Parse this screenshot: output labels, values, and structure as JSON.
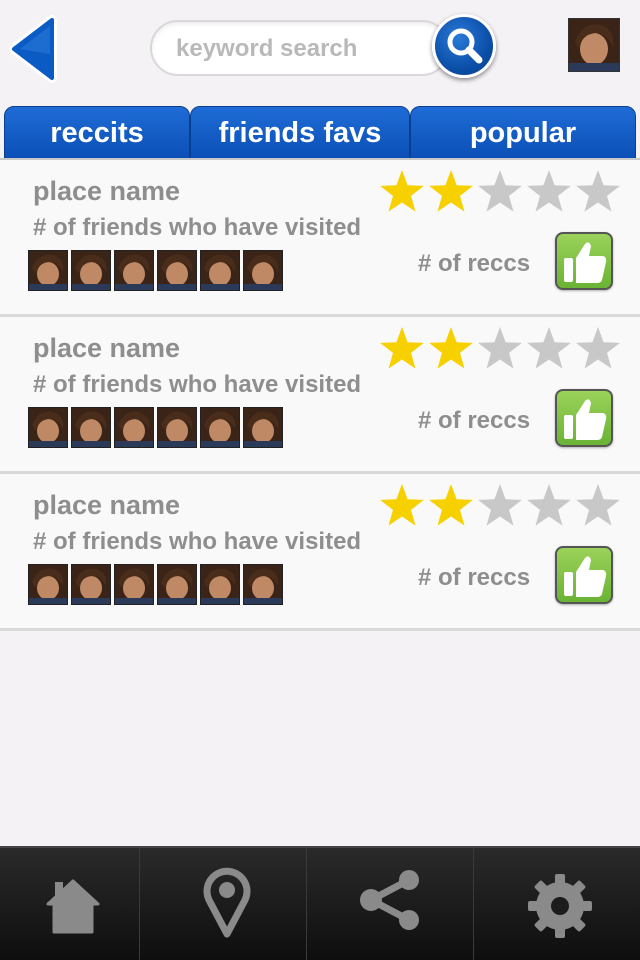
{
  "header": {
    "search_placeholder": "keyword search",
    "back_icon": "back-arrow-icon",
    "search_icon": "magnifier-icon"
  },
  "tabs": [
    {
      "label": "reccits"
    },
    {
      "label": "friends favs"
    },
    {
      "label": "popular"
    }
  ],
  "places": [
    {
      "name": "place name",
      "friends_text": "# of friends who have visited",
      "reccs_text": "# of reccs",
      "rating": 2,
      "max_rating": 5,
      "friend_count": 6
    },
    {
      "name": "place name",
      "friends_text": "# of friends who have visited",
      "reccs_text": "# of reccs",
      "rating": 2,
      "max_rating": 5,
      "friend_count": 6
    },
    {
      "name": "place name",
      "friends_text": "# of friends who have visited",
      "reccs_text": "# of reccs",
      "rating": 2,
      "max_rating": 5,
      "friend_count": 6
    }
  ],
  "nav": [
    {
      "icon": "home-icon"
    },
    {
      "icon": "map-pin-icon"
    },
    {
      "icon": "share-icon"
    },
    {
      "icon": "gear-icon"
    }
  ],
  "colors": {
    "tab_blue": "#0a4fb6",
    "star_filled": "#f7d000",
    "star_empty": "#c8c8c8",
    "thumb_green": "#7cc142",
    "nav_icon": "#8a8a8a"
  }
}
